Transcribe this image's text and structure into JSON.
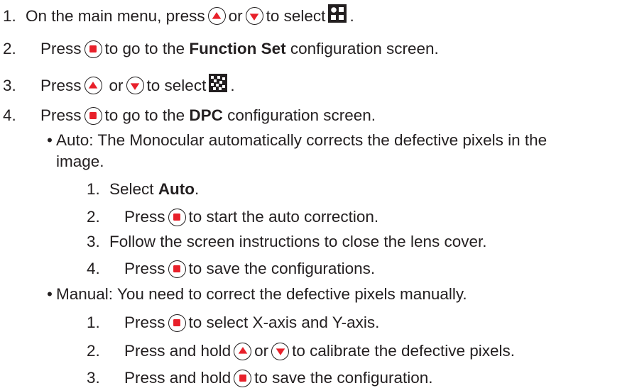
{
  "steps": [
    {
      "num": "1.",
      "a": "On the main menu, press",
      "or": "or",
      "b": "to select",
      "end": "."
    },
    {
      "num": "2.",
      "a": "Press",
      "b": "to go to the",
      "bold": "Function Set",
      "c": "configuration screen."
    },
    {
      "num": "3.",
      "a": "Press",
      "or": "or",
      "b": "to select",
      "end": "."
    },
    {
      "num": "4.",
      "a": "Press",
      "b": "to go to the",
      "bold": "DPC",
      "c": "configuration screen."
    }
  ],
  "bullet_char": "•",
  "auto": {
    "line1": "Auto: The Monocular automatically corrects the defective pixels in the",
    "line2": "image.",
    "steps": [
      {
        "num": "1.",
        "a": "Select",
        "bold": "Auto",
        "end": "."
      },
      {
        "num": "2.",
        "a": "Press",
        "b": "to start the auto correction."
      },
      {
        "num": "3.",
        "a": "Follow the screen instructions to close the lens cover."
      },
      {
        "num": "4.",
        "a": "Press",
        "b": "to save the configurations."
      }
    ]
  },
  "manual": {
    "line1": "Manual: You need to correct the defective pixels manually.",
    "steps": [
      {
        "num": "1.",
        "a": "Press",
        "b": "to select X-axis and Y-axis."
      },
      {
        "num": "2.",
        "a": "Press and hold",
        "or": "or",
        "b": "to calibrate the defective pixels."
      },
      {
        "num": "3.",
        "a": "Press and hold",
        "b": "to save the configuration."
      }
    ]
  },
  "icons": {
    "up": "up-arrow-button-icon",
    "down": "down-arrow-button-icon",
    "ok": "menu-confirm-button-icon",
    "function_set": "function-set-grid-icon",
    "dpc": "dpc-pixel-icon",
    "red": "#e8202a",
    "black": "#231f20"
  }
}
